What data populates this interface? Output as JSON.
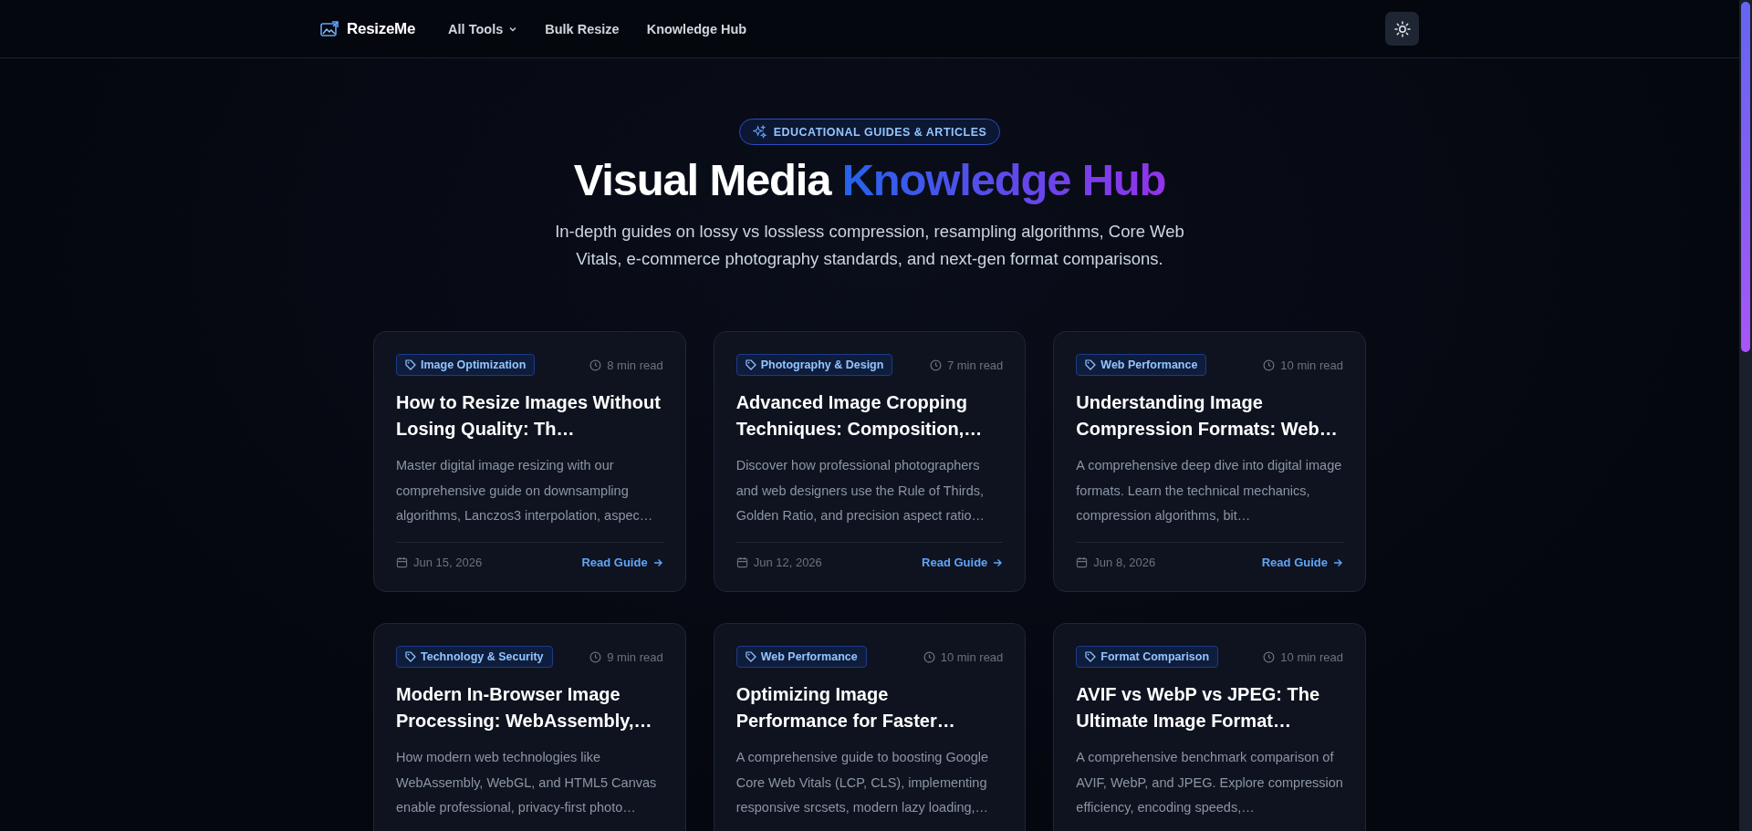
{
  "header": {
    "brand": "ResizeMe",
    "nav": [
      {
        "label": "All Tools",
        "dropdown": true
      },
      {
        "label": "Bulk Resize",
        "dropdown": false
      },
      {
        "label": "Knowledge Hub",
        "dropdown": false
      }
    ]
  },
  "hero": {
    "badge": "EDUCATIONAL GUIDES & ARTICLES",
    "title": "Visual Media",
    "title_highlight": "Knowledge Hub",
    "subtitle": "In-depth guides on lossy vs lossless compression, resampling algorithms, Core Web Vitals, e-commerce photography standards, and next-gen format comparisons."
  },
  "articles": [
    {
      "tag": "Image Optimization",
      "read_time": "8 min read",
      "title": "How to Resize Images Without Losing Quality: Th…",
      "excerpt": "Master digital image resizing with our comprehensive guide on downsampling algorithms, Lanczos3 interpolation, aspec…",
      "date": "Jun 15, 2026",
      "link": "Read Guide"
    },
    {
      "tag": "Photography & Design",
      "read_time": "7 min read",
      "title": "Advanced Image Cropping Techniques: Composition,…",
      "excerpt": "Discover how professional photographers and web designers use the Rule of Thirds, Golden Ratio, and precision aspect ratio…",
      "date": "Jun 12, 2026",
      "link": "Read Guide"
    },
    {
      "tag": "Web Performance",
      "read_time": "10 min read",
      "title": "Understanding Image Compression Formats: Web…",
      "excerpt": "A comprehensive deep dive into digital image formats. Learn the technical mechanics, compression algorithms, bit…",
      "date": "Jun 8, 2026",
      "link": "Read Guide"
    },
    {
      "tag": "Technology & Security",
      "read_time": "9 min read",
      "title": "Modern In-Browser Image Processing: WebAssembly,…",
      "excerpt": "How modern web technologies like WebAssembly, WebGL, and HTML5 Canvas enable professional, privacy-first photo…"
    },
    {
      "tag": "Web Performance",
      "read_time": "10 min read",
      "title": "Optimizing Image Performance for Faster…",
      "excerpt": "A comprehensive guide to boosting Google Core Web Vitals (LCP, CLS), implementing responsive srcsets, modern lazy loading,…"
    },
    {
      "tag": "Format Comparison",
      "read_time": "10 min read",
      "title": "AVIF vs WebP vs JPEG: The Ultimate Image Format…",
      "excerpt": "A comprehensive benchmark comparison of AVIF, WebP, and JPEG. Explore compression efficiency, encoding speeds,…"
    }
  ]
}
